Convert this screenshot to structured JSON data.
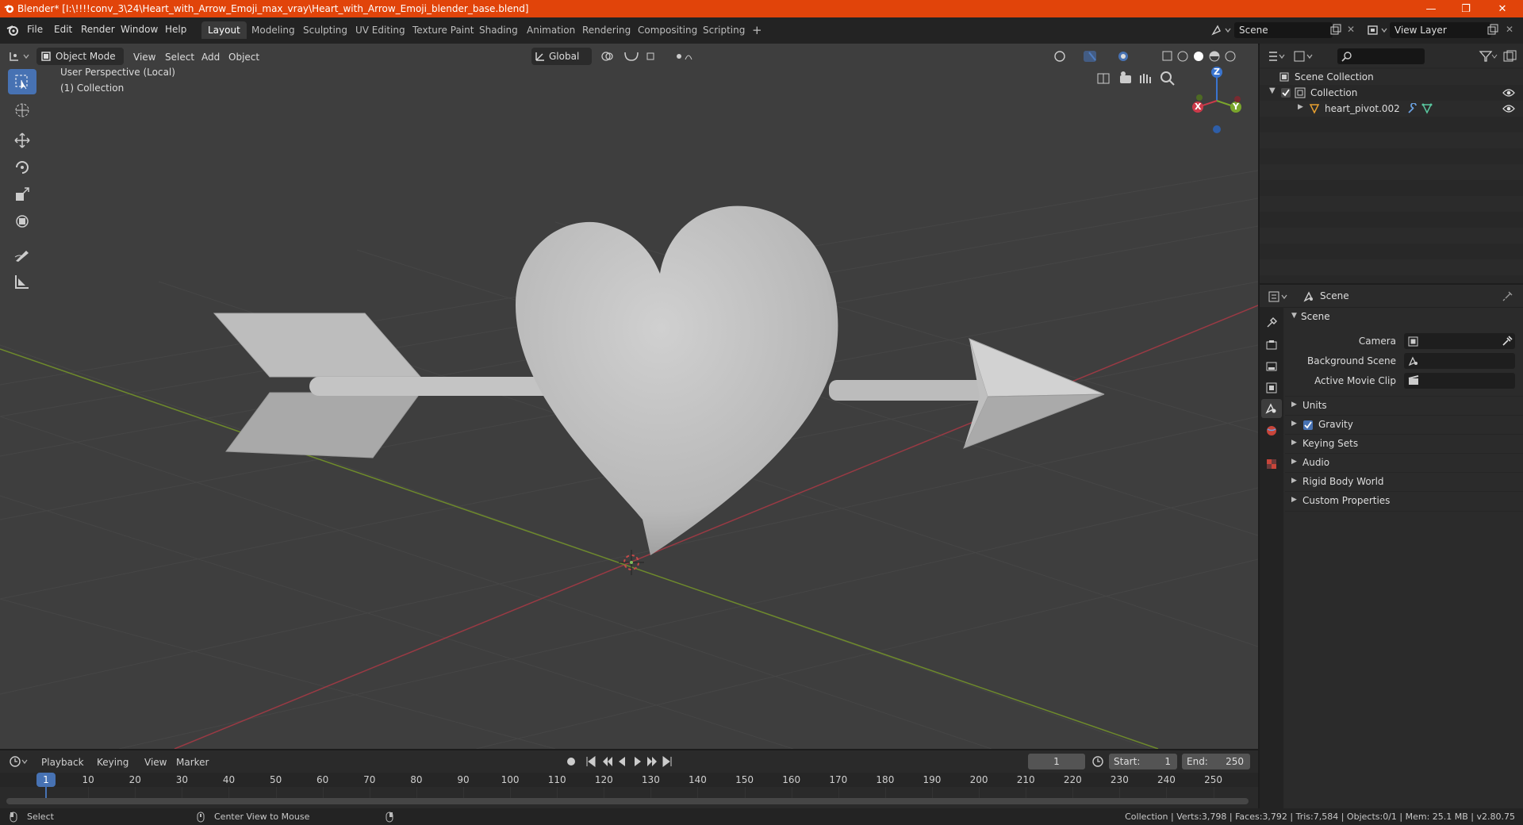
{
  "window": {
    "title": "Blender* [I:\\!!!!conv_3\\24\\Heart_with_Arrow_Emoji_max_vray\\Heart_with_Arrow_Emoji_blender_base.blend]",
    "minimize": "—",
    "maximize": "❐",
    "close": "✕"
  },
  "menubar": {
    "items": [
      "File",
      "Edit",
      "Render",
      "Window",
      "Help"
    ],
    "workspaces": [
      "Layout",
      "Modeling",
      "Sculpting",
      "UV Editing",
      "Texture Paint",
      "Shading",
      "Animation",
      "Rendering",
      "Compositing",
      "Scripting"
    ],
    "active_workspace": "Layout",
    "add_workspace": "+",
    "scene_label": "Scene",
    "view_layer_label": "View Layer"
  },
  "viewport": {
    "mode": "Object Mode",
    "menus": [
      "View",
      "Select",
      "Add",
      "Object"
    ],
    "orientation": "Global",
    "overlay_text_1": "User Perspective (Local)",
    "overlay_text_2": "(1) Collection",
    "gizmo": {
      "z": "Z",
      "x": "X",
      "y": "Y"
    }
  },
  "outliner": {
    "search_placeholder": "",
    "root": "Scene Collection",
    "collection": "Collection",
    "object": "heart_pivot.002"
  },
  "properties": {
    "header": "Scene",
    "panel_title": "Scene",
    "camera_label": "Camera",
    "background_scene_label": "Background Scene",
    "active_movie_clip_label": "Active Movie Clip",
    "panels": [
      "Units",
      "Gravity",
      "Keying Sets",
      "Audio",
      "Rigid Body World",
      "Custom Properties"
    ],
    "gravity_checked": true
  },
  "timeline": {
    "menus": [
      "Playback",
      "Keying",
      "View",
      "Marker"
    ],
    "current_frame": "1",
    "start_label": "Start:",
    "start_value": "1",
    "end_label": "End:",
    "end_value": "250",
    "ticks": [
      "10",
      "20",
      "30",
      "40",
      "50",
      "60",
      "70",
      "80",
      "90",
      "100",
      "110",
      "120",
      "130",
      "140",
      "150",
      "160",
      "170",
      "180",
      "190",
      "200",
      "210",
      "220",
      "230",
      "240",
      "250"
    ],
    "playhead": "1"
  },
  "statusbar": {
    "left_1": "Select",
    "left_2": "Center View to Mouse",
    "right": "Collection | Verts:3,798 | Faces:3,792 | Tris:7,584 | Objects:0/1 | Mem: 25.1 MB | v2.80.75"
  },
  "colors": {
    "titlebar": "#e1440a",
    "active_tool": "#4772b3",
    "axis_x": "#cc3a4a",
    "axis_y": "#7aa52c",
    "axis_z": "#3a75d0"
  }
}
